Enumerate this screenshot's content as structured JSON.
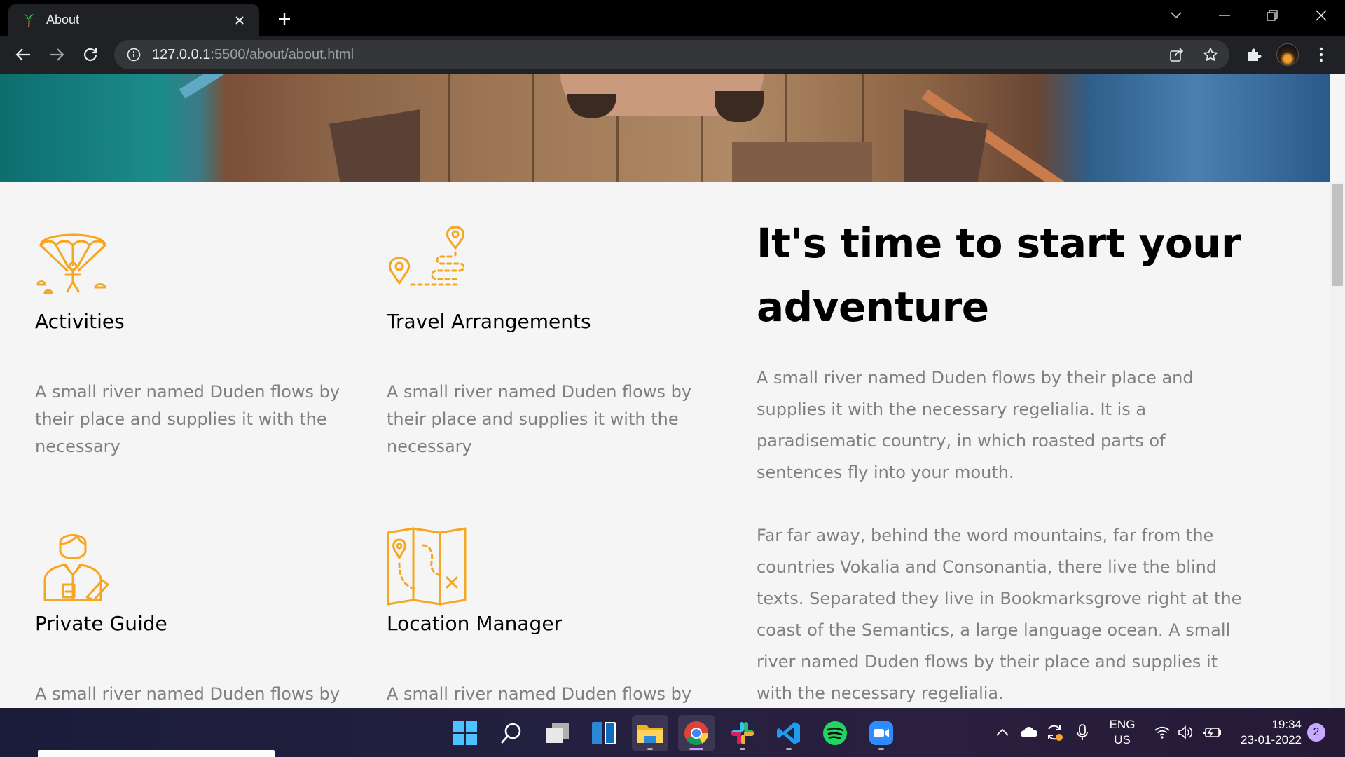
{
  "browser": {
    "tab_title": "About",
    "url_host": "127.0.0.1",
    "url_rest": ":5500/about/about.html"
  },
  "features": [
    {
      "title": "Activities",
      "text": "A small river named Duden flows by their place and supplies it with the necessary",
      "icon": "parachute-icon"
    },
    {
      "title": "Travel Arrangements",
      "text": "A small river named Duden flows by their place and supplies it with the necessary",
      "icon": "route-pin-icon"
    },
    {
      "title": "Private Guide",
      "text": "A small river named Duden flows by",
      "icon": "guide-person-icon"
    },
    {
      "title": "Location Manager",
      "text": "A small river named Duden flows by",
      "icon": "folded-map-icon"
    }
  ],
  "about": {
    "headline": "It's time to start your adventure",
    "paragraph1": "A small river named Duden flows by their place and supplies it with the necessary regelialia. It is a paradisematic country, in which roasted parts of sentences fly into your mouth.",
    "paragraph2": "Far far away, behind the word mountains, far from the countries Vokalia and Consonantia, there live the blind texts. Separated they live in Bookmarksgrove right at the coast of the Semantics, a large language ocean. A small river named Duden flows by their place and supplies it with the necessary regelialia."
  },
  "colors": {
    "icon_orange": "#f5a623",
    "heading": "#000000",
    "body_text": "#808080"
  },
  "taskbar": {
    "apps": [
      "windows-start",
      "search",
      "task-view",
      "widgets",
      "file-explorer",
      "chrome",
      "slack",
      "vscode",
      "spotify",
      "zoom"
    ],
    "language_line1": "ENG",
    "language_line2": "US",
    "time": "19:34",
    "date": "23-01-2022",
    "notification_count": "2"
  }
}
